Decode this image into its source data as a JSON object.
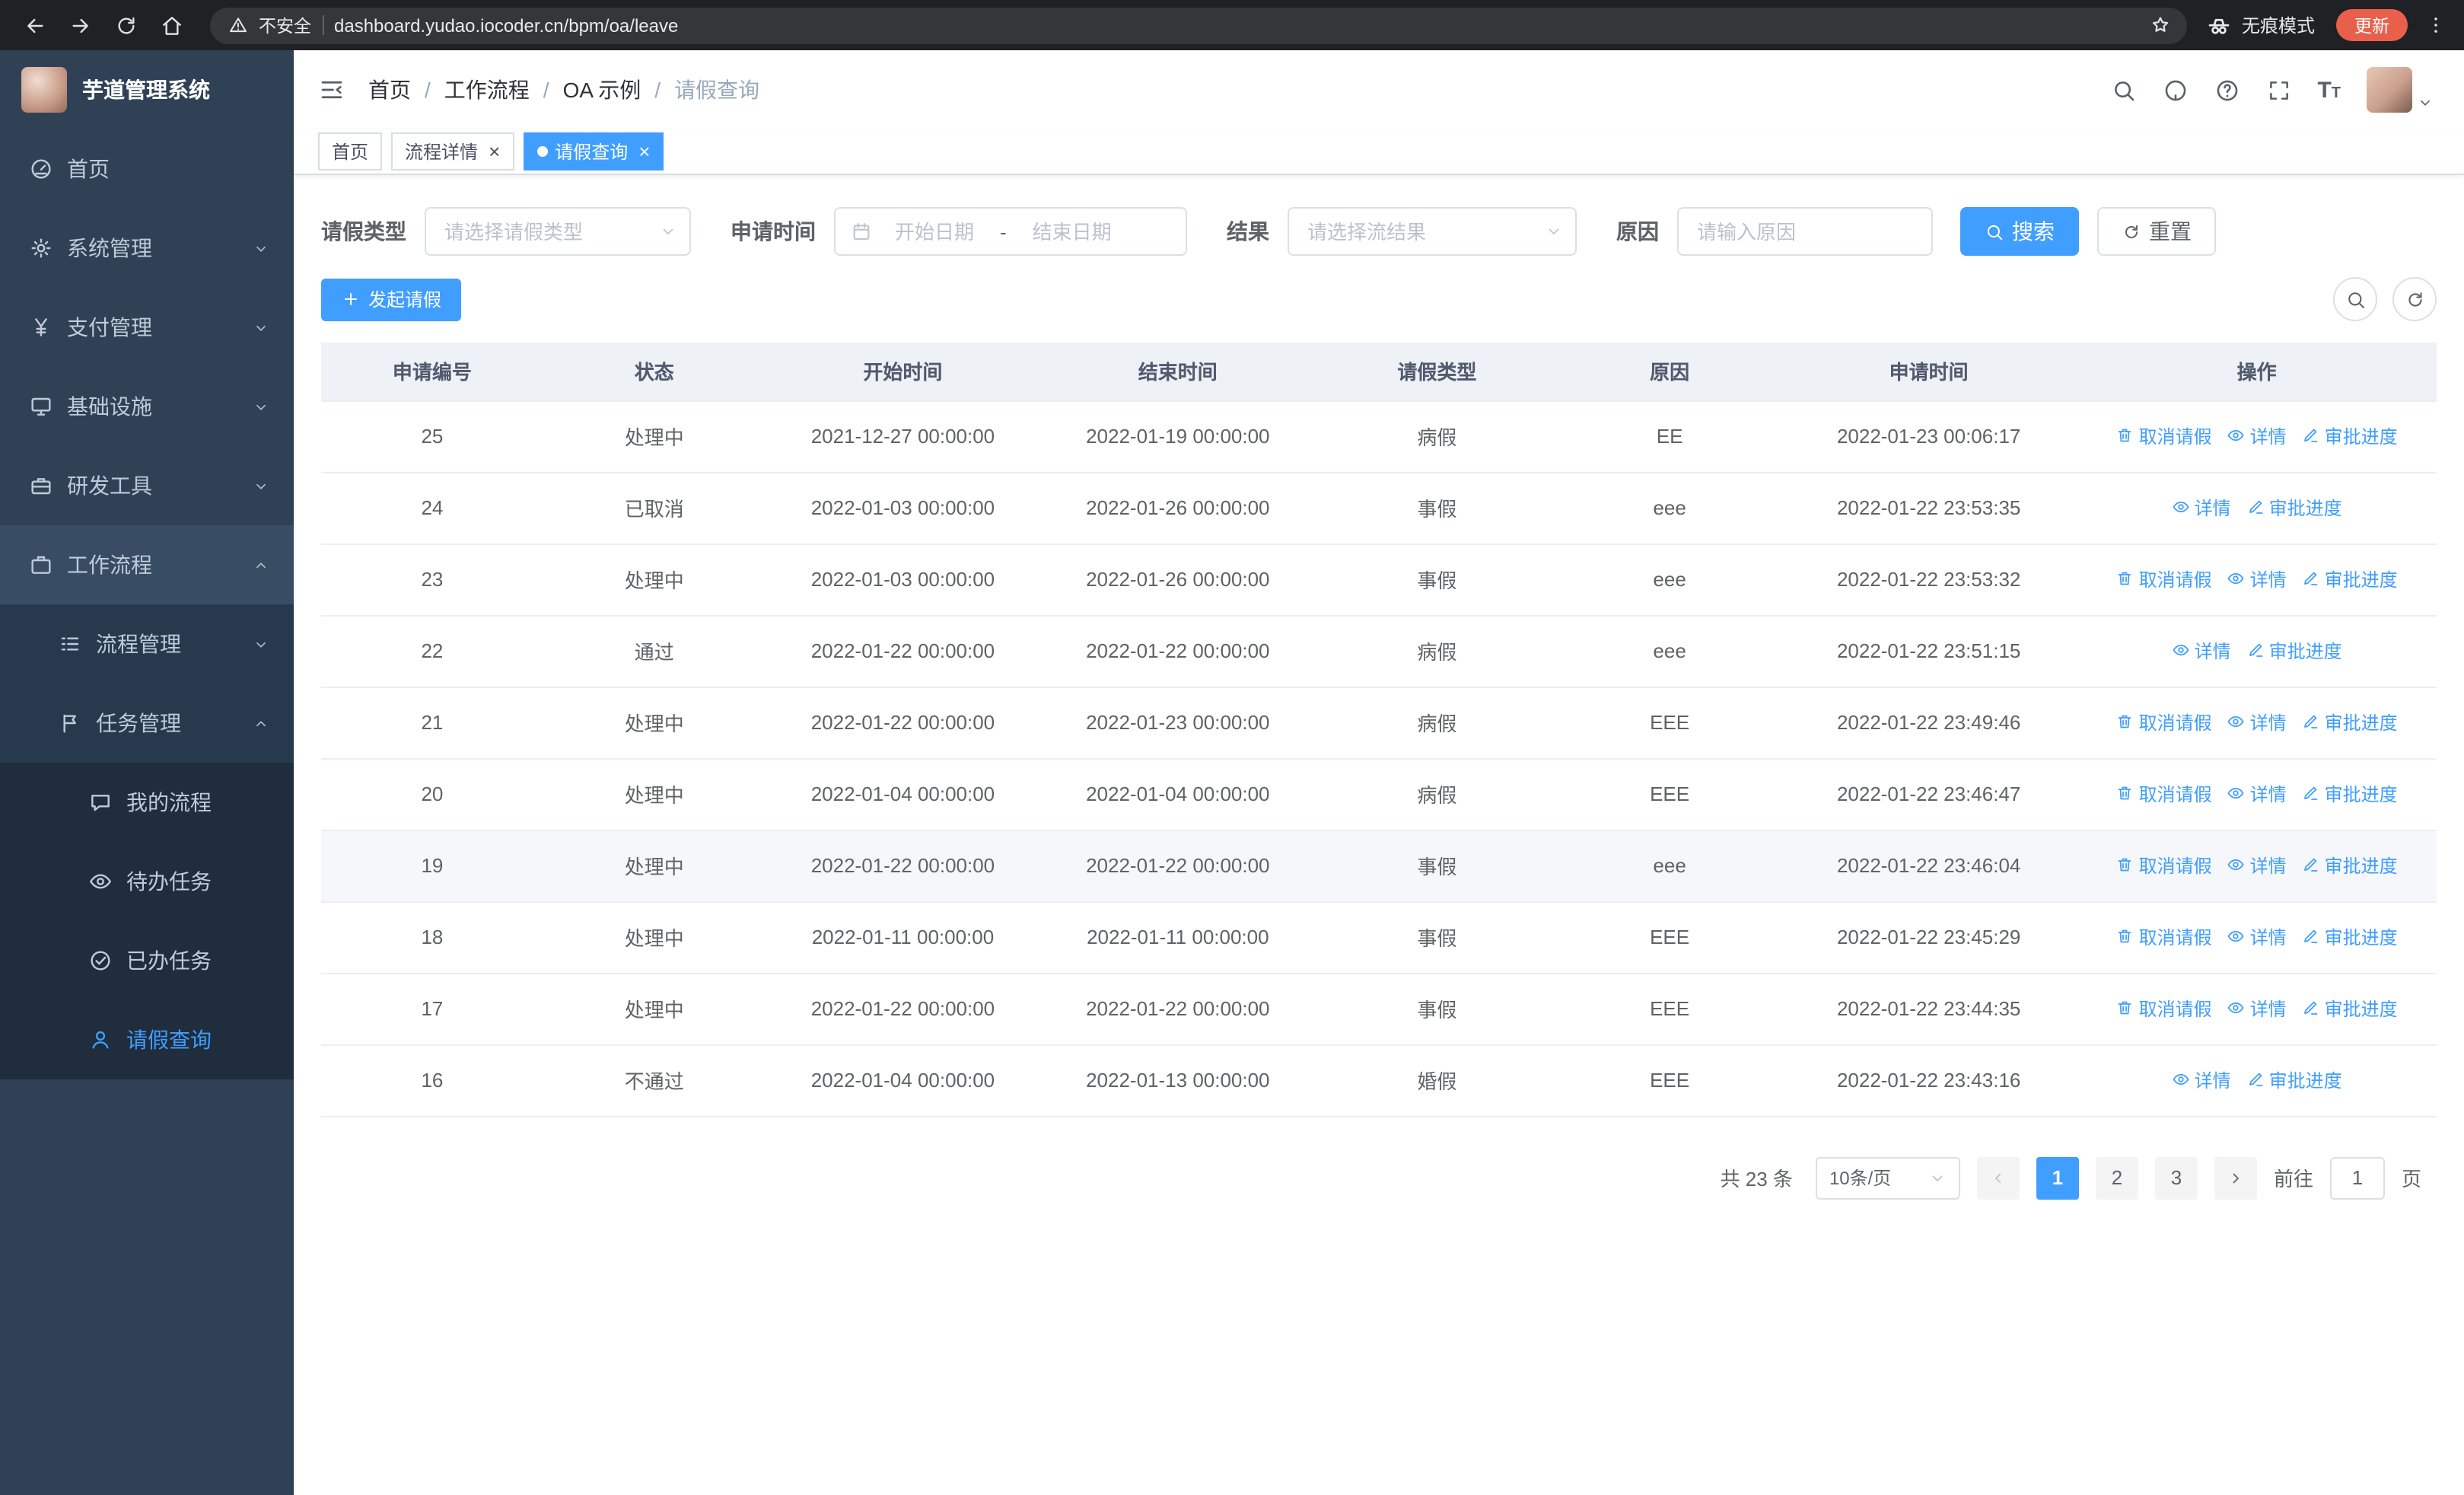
{
  "browser": {
    "security_warning": "不安全",
    "url": "dashboard.yudao.iocoder.cn/bpm/oa/leave",
    "incognito_label": "无痕模式",
    "update_label": "更新"
  },
  "sidebar": {
    "app_title": "芋道管理系统",
    "menu": [
      {
        "label": "首页",
        "icon": "dashboard-icon",
        "level": 1
      },
      {
        "label": "系统管理",
        "icon": "gear-icon",
        "level": 1,
        "chevron": "down"
      },
      {
        "label": "支付管理",
        "icon": "yen-icon",
        "level": 1,
        "chevron": "down"
      },
      {
        "label": "基础设施",
        "icon": "monitor-icon",
        "level": 1,
        "chevron": "down"
      },
      {
        "label": "研发工具",
        "icon": "toolbox-icon",
        "level": 1,
        "chevron": "down"
      },
      {
        "label": "工作流程",
        "icon": "briefcase-icon",
        "level": 1,
        "chevron": "up",
        "open": true
      },
      {
        "label": "流程管理",
        "icon": "process-icon",
        "level": 2,
        "chevron": "down"
      },
      {
        "label": "任务管理",
        "icon": "task-icon",
        "level": 2,
        "chevron": "up",
        "open": true
      },
      {
        "label": "我的流程",
        "icon": "chat-icon",
        "level": 3
      },
      {
        "label": "待办任务",
        "icon": "eye-icon",
        "level": 3
      },
      {
        "label": "已办任务",
        "icon": "check-icon",
        "level": 3
      },
      {
        "label": "请假查询",
        "icon": "user-icon",
        "level": 3,
        "active": true
      }
    ]
  },
  "header": {
    "breadcrumb": [
      "首页",
      "工作流程",
      "OA 示例",
      "请假查询"
    ]
  },
  "tabs": [
    {
      "label": "首页",
      "closable": false,
      "active": false
    },
    {
      "label": "流程详情",
      "closable": true,
      "active": false
    },
    {
      "label": "请假查询",
      "closable": true,
      "active": true
    }
  ],
  "filters": {
    "leave_type_label": "请假类型",
    "leave_type_placeholder": "请选择请假类型",
    "apply_time_label": "申请时间",
    "start_date_placeholder": "开始日期",
    "range_separator": "-",
    "end_date_placeholder": "结束日期",
    "result_label": "结果",
    "result_placeholder": "请选择流结果",
    "reason_label": "原因",
    "reason_placeholder": "请输入原因",
    "search_button": "搜索",
    "reset_button": "重置"
  },
  "toolbar": {
    "create_button": "发起请假"
  },
  "table": {
    "headers": [
      "申请编号",
      "状态",
      "开始时间",
      "结束时间",
      "请假类型",
      "原因",
      "申请时间",
      "操作"
    ],
    "action_defs": {
      "cancel": {
        "label": "取消请假",
        "icon": "trash-icon"
      },
      "detail": {
        "label": "详情",
        "icon": "eye-icon"
      },
      "progress": {
        "label": "审批进度",
        "icon": "pen-icon"
      }
    },
    "rows": [
      {
        "id": "25",
        "status": "处理中",
        "start": "2021-12-27 00:00:00",
        "end": "2022-01-19 00:00:00",
        "type": "病假",
        "reason": "EE",
        "apply_time": "2022-01-23 00:06:17",
        "actions": [
          "cancel",
          "detail",
          "progress"
        ]
      },
      {
        "id": "24",
        "status": "已取消",
        "start": "2022-01-03 00:00:00",
        "end": "2022-01-26 00:00:00",
        "type": "事假",
        "reason": "eee",
        "apply_time": "2022-01-22 23:53:35",
        "actions": [
          "detail",
          "progress"
        ]
      },
      {
        "id": "23",
        "status": "处理中",
        "start": "2022-01-03 00:00:00",
        "end": "2022-01-26 00:00:00",
        "type": "事假",
        "reason": "eee",
        "apply_time": "2022-01-22 23:53:32",
        "actions": [
          "cancel",
          "detail",
          "progress"
        ]
      },
      {
        "id": "22",
        "status": "通过",
        "start": "2022-01-22 00:00:00",
        "end": "2022-01-22 00:00:00",
        "type": "病假",
        "reason": "eee",
        "apply_time": "2022-01-22 23:51:15",
        "actions": [
          "detail",
          "progress"
        ]
      },
      {
        "id": "21",
        "status": "处理中",
        "start": "2022-01-22 00:00:00",
        "end": "2022-01-23 00:00:00",
        "type": "病假",
        "reason": "EEE",
        "apply_time": "2022-01-22 23:49:46",
        "actions": [
          "cancel",
          "detail",
          "progress"
        ]
      },
      {
        "id": "20",
        "status": "处理中",
        "start": "2022-01-04 00:00:00",
        "end": "2022-01-04 00:00:00",
        "type": "病假",
        "reason": "EEE",
        "apply_time": "2022-01-22 23:46:47",
        "actions": [
          "cancel",
          "detail",
          "progress"
        ]
      },
      {
        "id": "19",
        "status": "处理中",
        "start": "2022-01-22 00:00:00",
        "end": "2022-01-22 00:00:00",
        "type": "事假",
        "reason": "eee",
        "apply_time": "2022-01-22 23:46:04",
        "actions": [
          "cancel",
          "detail",
          "progress"
        ],
        "highlighted": true
      },
      {
        "id": "18",
        "status": "处理中",
        "start": "2022-01-11 00:00:00",
        "end": "2022-01-11 00:00:00",
        "type": "事假",
        "reason": "EEE",
        "apply_time": "2022-01-22 23:45:29",
        "actions": [
          "cancel",
          "detail",
          "progress"
        ]
      },
      {
        "id": "17",
        "status": "处理中",
        "start": "2022-01-22 00:00:00",
        "end": "2022-01-22 00:00:00",
        "type": "事假",
        "reason": "EEE",
        "apply_time": "2022-01-22 23:44:35",
        "actions": [
          "cancel",
          "detail",
          "progress"
        ]
      },
      {
        "id": "16",
        "status": "不通过",
        "start": "2022-01-04 00:00:00",
        "end": "2022-01-13 00:00:00",
        "type": "婚假",
        "reason": "EEE",
        "apply_time": "2022-01-22 23:43:16",
        "actions": [
          "detail",
          "progress"
        ]
      }
    ]
  },
  "pagination": {
    "total_text": "共 23 条",
    "page_size": "10条/页",
    "pages": [
      "1",
      "2",
      "3"
    ],
    "active_page": "1",
    "goto_label": "前往",
    "goto_value": "1",
    "page_unit": "页"
  },
  "colors": {
    "accent": "#409eff",
    "sidebar_bg": "#304156",
    "sidebar_submenu_bg": "#1f2d3d",
    "browser_bar_bg": "#202124"
  }
}
